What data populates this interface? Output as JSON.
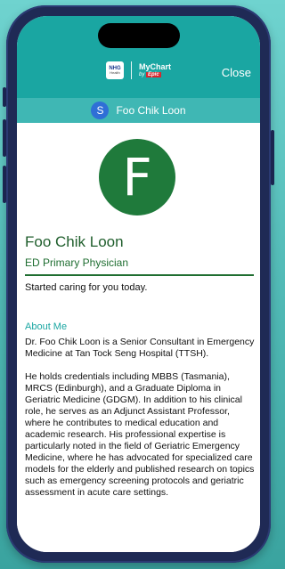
{
  "header": {
    "nhg_logo_text": "NHG",
    "nhg_logo_sub": "Health",
    "mychart_text": "MyChart",
    "mychart_by": "by",
    "epic_text": "Epic",
    "close_label": "Close"
  },
  "patient_bar": {
    "initial": "S",
    "name": "Foo Chik Loon"
  },
  "provider": {
    "initial": "F",
    "name": "Foo Chik Loon",
    "role": "ED Primary Physician",
    "status": "Started caring for you today."
  },
  "about": {
    "heading": "About Me",
    "paragraph1": "Dr. Foo Chik Loon is a Senior Consultant in Emergency Medicine at Tan Tock Seng Hospital (TTSH).",
    "paragraph2": "He holds credentials including MBBS (Tasmania), MRCS (Edinburgh), and a Graduate Diploma in Geriatric Medicine (GDGM). In addition to his clinical role, he serves as an Adjunct Assistant Professor, where he contributes to medical education and academic research. His professional expertise is particularly noted in the field of Geriatric Emergency Medicine, where he has advocated for specialized care models for the elderly and published research on topics such as emergency screening protocols and geriatric assessment in acute care settings."
  },
  "colors": {
    "header_teal": "#1aa6a2",
    "namebar_teal": "#3fb7b4",
    "provider_green": "#1f7a3b",
    "patient_avatar_blue": "#2f6fd6"
  }
}
